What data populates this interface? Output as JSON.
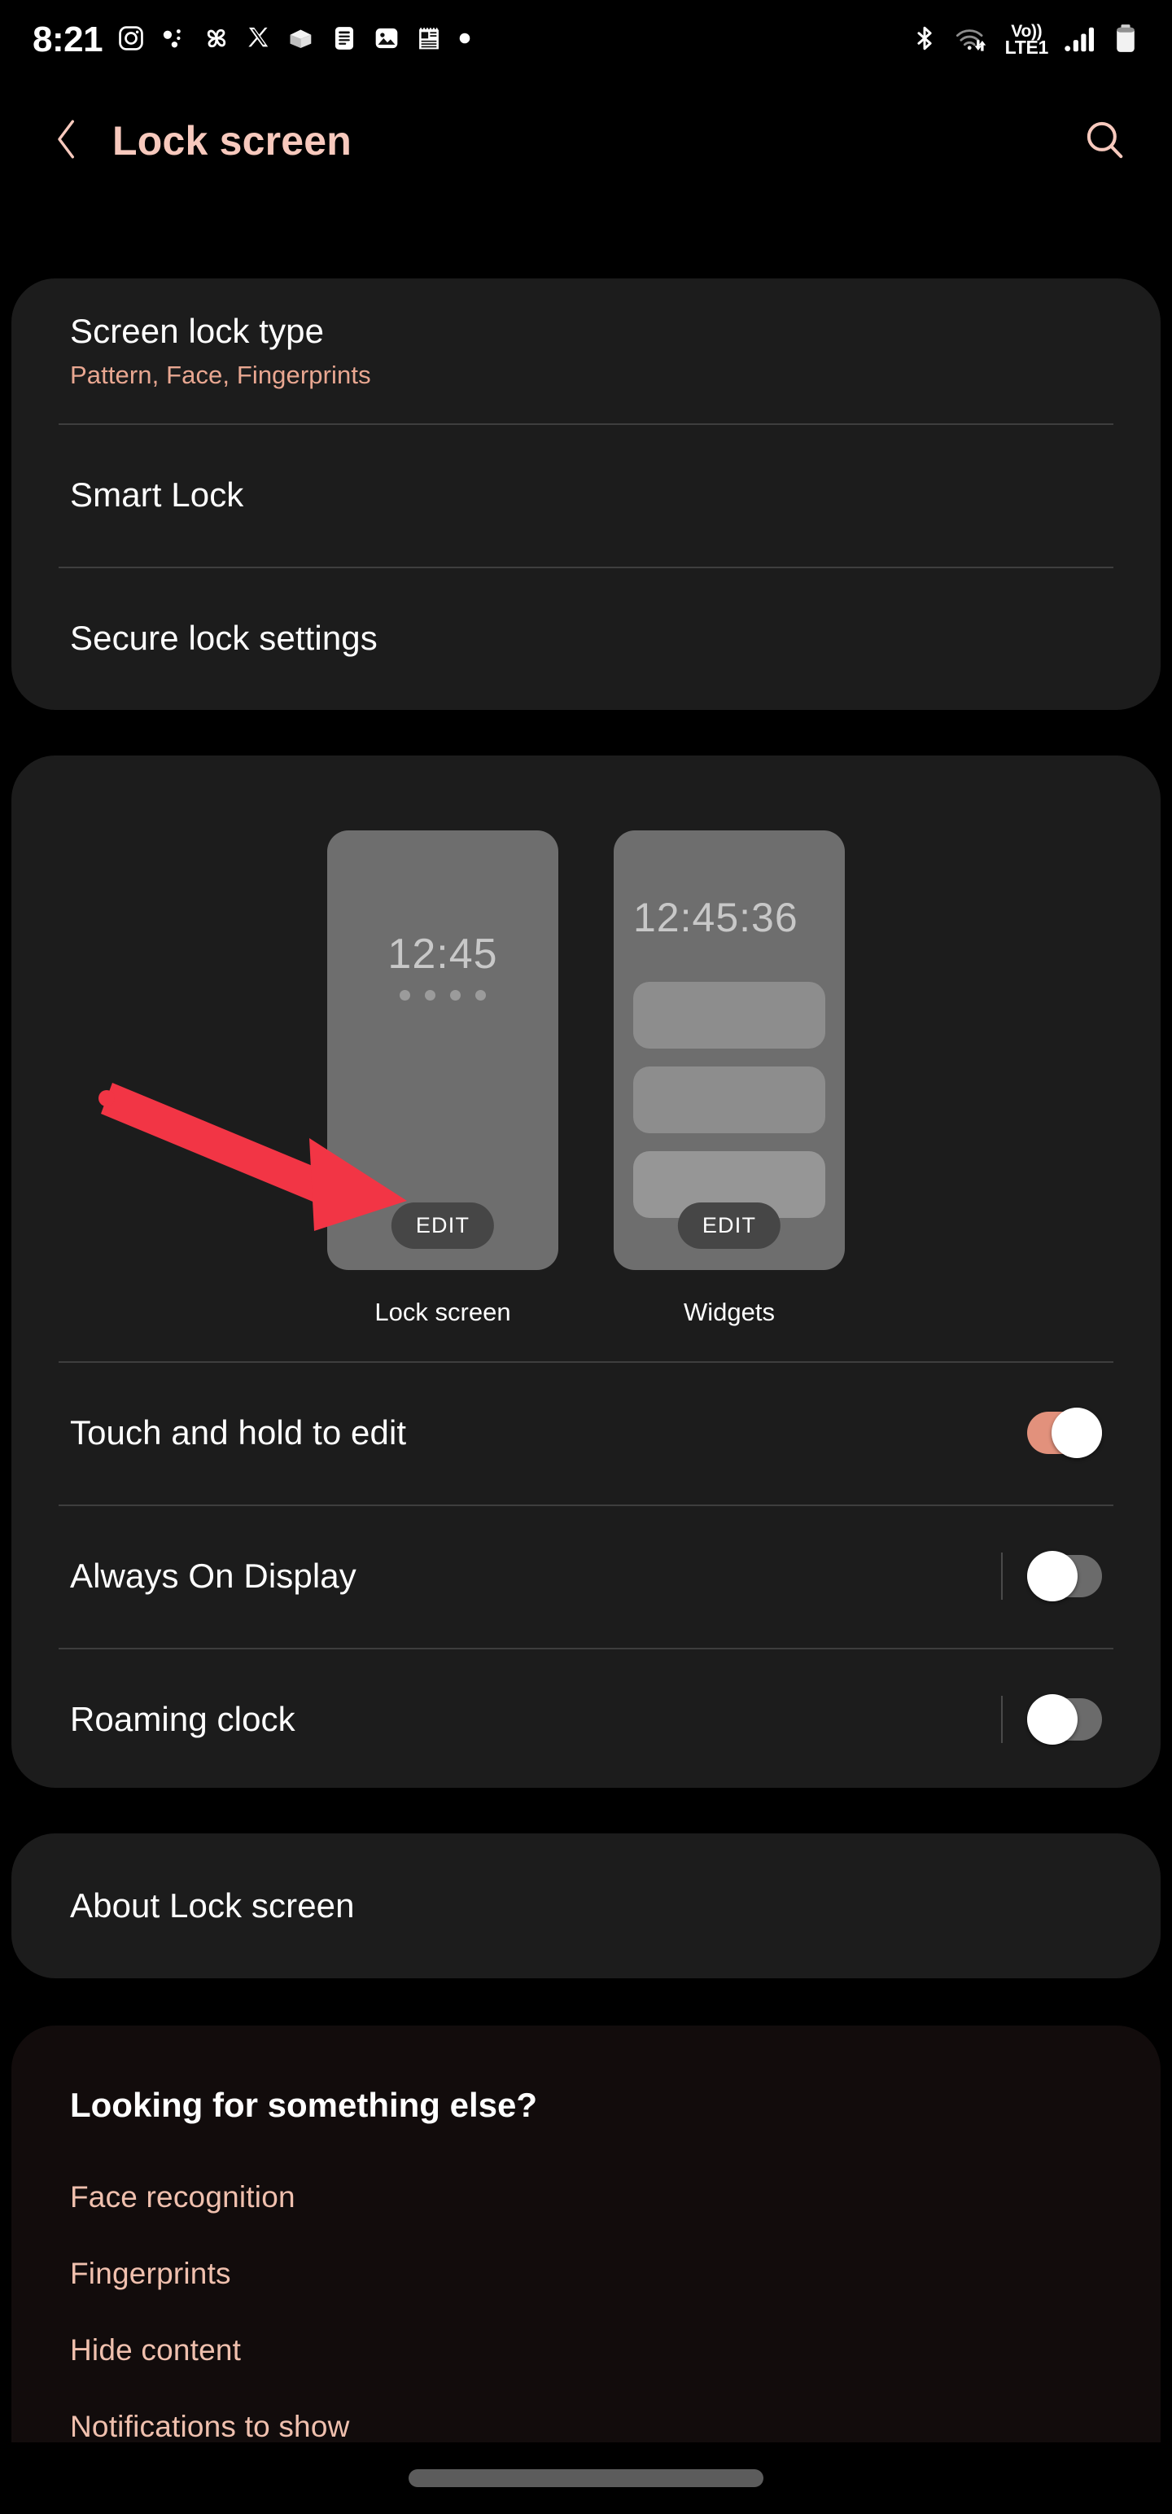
{
  "status_bar": {
    "clock": "8:21",
    "left_icons": [
      {
        "name": "instagram-icon"
      },
      {
        "name": "dots-cluster-icon"
      },
      {
        "name": "pinwheel-icon"
      },
      {
        "name": "x-twitter-icon"
      },
      {
        "name": "package-box-icon"
      },
      {
        "name": "document-icon"
      },
      {
        "name": "photo-icon"
      },
      {
        "name": "notepad-icon"
      },
      {
        "name": "more-dot-icon"
      }
    ],
    "right_icons": [
      {
        "name": "bluetooth-icon"
      },
      {
        "name": "wifi-data-transfer-icon"
      },
      {
        "name": "signal-bars-icon"
      },
      {
        "name": "battery-icon"
      }
    ],
    "network_label_top": "Vo))",
    "network_label_bottom": "LTE1"
  },
  "header": {
    "title": "Lock screen",
    "back_icon": "chevron-left-icon",
    "search_icon": "search-icon"
  },
  "security_card": {
    "screen_lock_type": {
      "title": "Screen lock type",
      "summary": "Pattern, Face, Fingerprints"
    },
    "smart_lock": {
      "title": "Smart Lock"
    },
    "secure_lock_settings": {
      "title": "Secure lock settings"
    }
  },
  "preview_card": {
    "lock_screen_preview": {
      "caption": "Lock screen",
      "clock": "12:45",
      "dot_count": 4,
      "edit_label": "EDIT"
    },
    "widgets_preview": {
      "caption": "Widgets",
      "clock": "12:45:36",
      "widget_count": 3,
      "edit_label": "EDIT"
    },
    "toggles": [
      {
        "label": "Touch and hold to edit",
        "state": "on",
        "has_separator": false
      },
      {
        "label": "Always On Display",
        "state": "off",
        "has_separator": true
      },
      {
        "label": "Roaming clock",
        "state": "off",
        "has_separator": true
      }
    ]
  },
  "about_card": {
    "title": "About Lock screen"
  },
  "more_card": {
    "heading": "Looking for something else?",
    "links": [
      "Face recognition",
      "Fingerprints",
      "Hide content",
      "Notifications to show"
    ]
  },
  "annotation": {
    "type": "arrow",
    "color": "#f23545",
    "points_to": "lock-screen-edit-button"
  },
  "nav_bar": {
    "gesture_pill": "home-gesture-pill"
  },
  "colors": {
    "background": "#000000",
    "card": "#1c1c1c",
    "accent_pink": "#f7c9bd",
    "accent_salmon": "#e2917c",
    "link_pink": "#f0c0ae",
    "thumb_gray": "#6e6e6e",
    "arrow_red": "#f23545"
  }
}
